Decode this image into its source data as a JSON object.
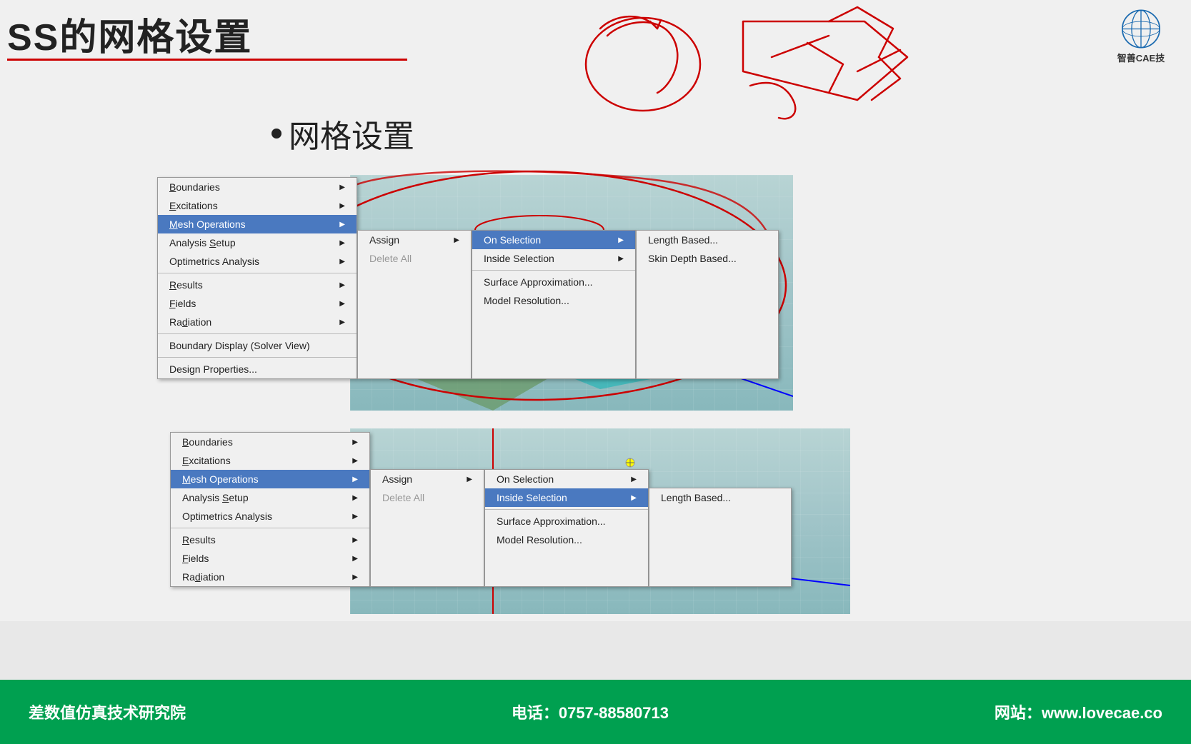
{
  "title": "SS的网格设置",
  "title_underline": true,
  "bullet": "网格设置",
  "logo_text": "智善CAE技",
  "bottom_bar": {
    "left": "差数值仿真技术研究院",
    "center": "电话：0757-88580713",
    "right": "网站：www.lovecae.co"
  },
  "upper_menu": {
    "main_items": [
      {
        "label": "Boundaries",
        "underline_idx": 0,
        "has_arrow": true
      },
      {
        "label": "Excitations",
        "underline_idx": 0,
        "has_arrow": true
      },
      {
        "label": "Mesh Operations",
        "underline_idx": 0,
        "has_arrow": true,
        "highlighted": true
      },
      {
        "label": "Analysis Setup",
        "underline_idx": 9,
        "has_arrow": true
      },
      {
        "label": "Optimetrics Analysis",
        "has_arrow": true
      },
      {
        "label": "",
        "separator": true
      },
      {
        "label": "Results",
        "underline_idx": 0,
        "has_arrow": true
      },
      {
        "label": "Fields",
        "underline_idx": 0,
        "has_arrow": true
      },
      {
        "label": "Radiation",
        "underline_idx": 0,
        "has_arrow": true
      },
      {
        "label": "",
        "separator": true
      },
      {
        "label": "Boundary Display (Solver View)",
        "has_arrow": false
      },
      {
        "label": "",
        "separator": true
      },
      {
        "label": "Design Properties...",
        "has_arrow": false
      }
    ],
    "assign_menu": [
      {
        "label": "Assign",
        "has_arrow": true
      },
      {
        "label": "Delete All",
        "disabled": true
      }
    ],
    "on_selection_menu": [
      {
        "label": "On Selection",
        "has_arrow": true,
        "highlighted": true
      },
      {
        "label": "Inside Selection",
        "has_arrow": true
      },
      {
        "label": "",
        "separator": true
      },
      {
        "label": "Surface Approximation...",
        "has_arrow": false
      },
      {
        "label": "Model Resolution...",
        "has_arrow": false
      }
    ],
    "length_menu": [
      {
        "label": "Length Based...",
        "has_arrow": false
      },
      {
        "label": "Skin Depth Based...",
        "has_arrow": false
      }
    ]
  },
  "lower_menu": {
    "main_items": [
      {
        "label": "Boundaries",
        "underline_idx": 0,
        "has_arrow": true
      },
      {
        "label": "Excitations",
        "underline_idx": 0,
        "has_arrow": true
      },
      {
        "label": "Mesh Operations",
        "underline_idx": 0,
        "has_arrow": true,
        "highlighted": true
      },
      {
        "label": "Analysis Setup",
        "underline_idx": 9,
        "has_arrow": true
      },
      {
        "label": "Optimetrics Analysis",
        "has_arrow": true
      },
      {
        "label": "",
        "separator": true
      },
      {
        "label": "Results",
        "underline_idx": 0,
        "has_arrow": true
      },
      {
        "label": "Fields",
        "underline_idx": 0,
        "has_arrow": true
      },
      {
        "label": "Radiation",
        "underline_idx": 0,
        "has_arrow": true
      }
    ],
    "assign_menu": [
      {
        "label": "Assign",
        "has_arrow": true
      },
      {
        "label": "Delete All",
        "disabled": true
      }
    ],
    "on_selection_menu": [
      {
        "label": "On Selection",
        "has_arrow": true
      },
      {
        "label": "Inside Selection",
        "has_arrow": true,
        "highlighted": true
      },
      {
        "label": "",
        "separator": true
      },
      {
        "label": "Surface Approximation...",
        "has_arrow": false
      },
      {
        "label": "Model Resolution...",
        "has_arrow": false
      }
    ],
    "length_menu": [
      {
        "label": "Length Based...",
        "has_arrow": false
      }
    ]
  }
}
